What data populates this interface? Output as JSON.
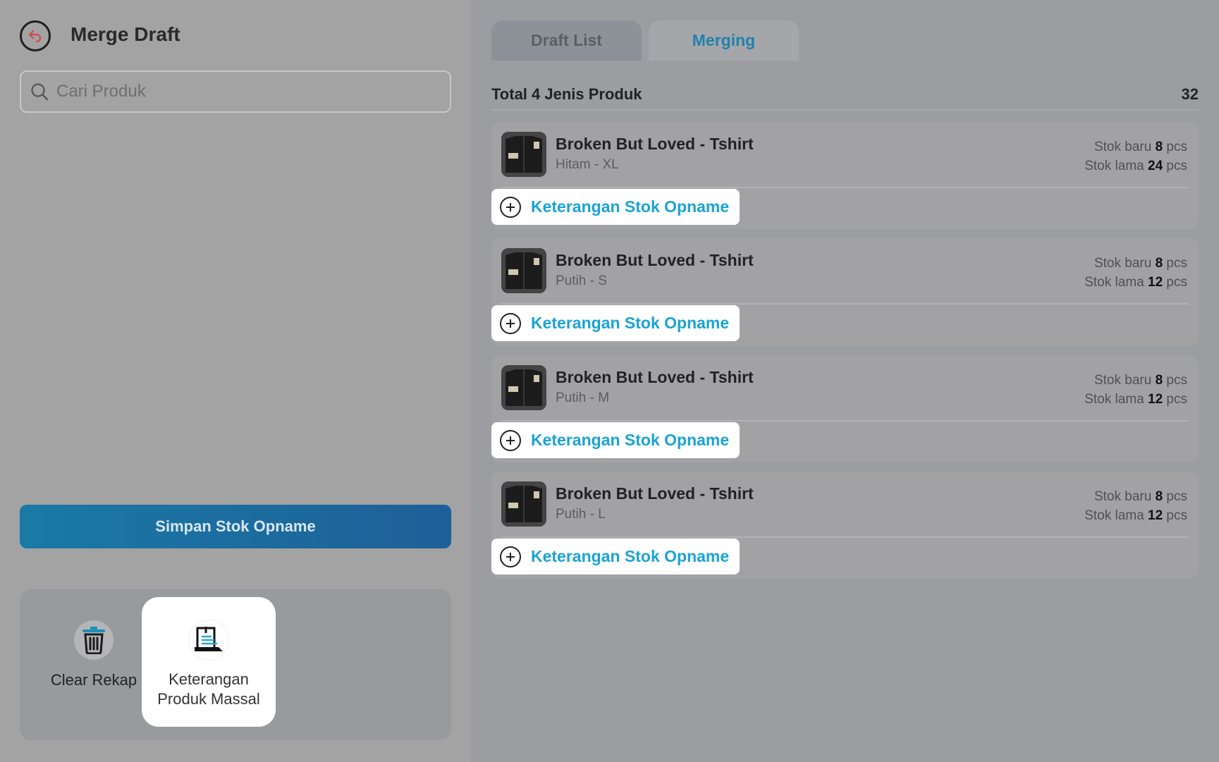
{
  "header": {
    "title": "Merge Draft"
  },
  "search": {
    "placeholder": "Cari Produk",
    "value": ""
  },
  "actions": {
    "save_label": "Simpan Stok Opname"
  },
  "tools": {
    "clear_label": "Clear Rekap",
    "mass_label_line1": "Keterangan",
    "mass_label_line2": "Produk Massal"
  },
  "tabs": [
    {
      "label": "Draft List",
      "active": false
    },
    {
      "label": "Merging",
      "active": true
    }
  ],
  "summary": {
    "label": "Total 4 Jenis Produk",
    "count": "32"
  },
  "stock_labels": {
    "new": "Stok baru",
    "old": "Stok lama",
    "unit": "pcs"
  },
  "note_label": "Keterangan Stok Opname",
  "products": [
    {
      "name": "Broken But Loved - Tshirt",
      "variant": "Hitam  - XL",
      "stock_new": "8",
      "stock_old": "24"
    },
    {
      "name": "Broken But Loved - Tshirt",
      "variant": "Putih - S",
      "stock_new": "8",
      "stock_old": "12"
    },
    {
      "name": "Broken But Loved - Tshirt",
      "variant": "Putih - M",
      "stock_new": "8",
      "stock_old": "12"
    },
    {
      "name": "Broken But Loved - Tshirt",
      "variant": "Putih - L",
      "stock_new": "8",
      "stock_old": "12"
    }
  ],
  "colors": {
    "accent": "#1aa3d4",
    "save_button": "#1a7aa6",
    "tab_active_text": "#1f82ad"
  }
}
